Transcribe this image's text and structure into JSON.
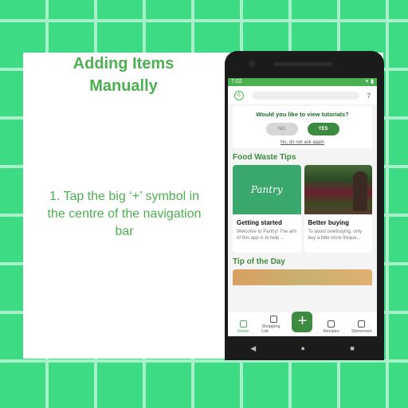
{
  "slide": {
    "title": "Adding Items\nManually",
    "instruction": "1. Tap the big ‘+’ symbol in the centre of the navigation bar"
  },
  "status_bar": {
    "time": "7:02"
  },
  "top_bar": {
    "left_value": "6",
    "right_value": "7"
  },
  "tutorial_prompt": {
    "question": "Would you like to view tutorials?",
    "no_label": "NO",
    "yes_label": "YES",
    "skip_label": "No, do not ask again"
  },
  "food_waste": {
    "title": "Food Waste Tips",
    "cards": [
      {
        "image_text": "Pantry",
        "title": "Getting started",
        "desc": "Welcome to Pantry! The aim of this app is to help ..."
      },
      {
        "title": "Better buying",
        "desc": "To avoid overbuying, only buy a little more freque..."
      }
    ]
  },
  "tip_of_day": {
    "title": "Tip of the Day"
  },
  "nav": {
    "home": "Home",
    "shopping": "Shopping List",
    "add": "+",
    "recipes": "Recipes",
    "storeroom": "Storeroom"
  },
  "colors": {
    "brand_green": "#4caf50",
    "dark_green": "#3d8b40",
    "background_green": "#3ddc84"
  }
}
